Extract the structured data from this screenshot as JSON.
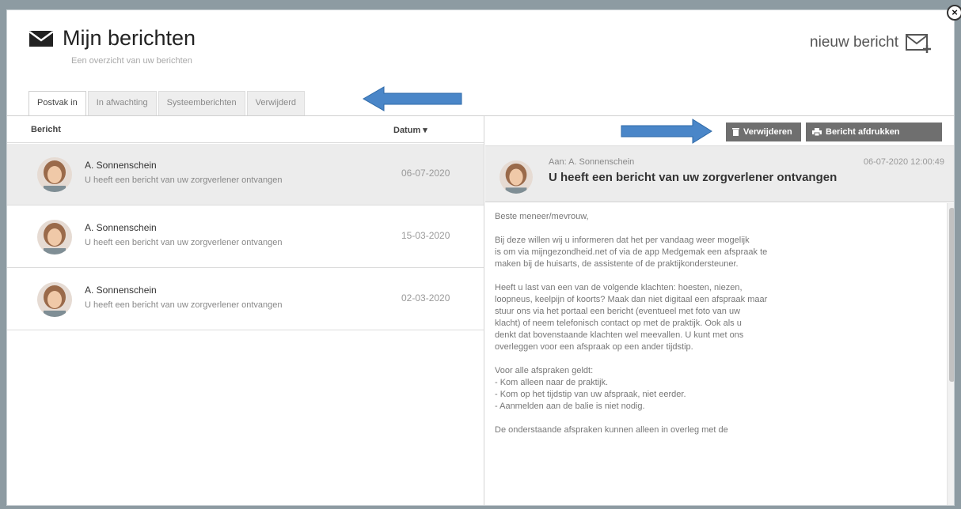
{
  "header": {
    "title": "Mijn berichten",
    "subtitle": "Een overzicht van uw berichten",
    "new_message_label": "nieuw bericht"
  },
  "tabs": [
    {
      "label": "Postvak in",
      "active": true
    },
    {
      "label": "In afwachting",
      "active": false
    },
    {
      "label": "Systeemberichten",
      "active": false
    },
    {
      "label": "Verwijderd",
      "active": false
    }
  ],
  "list": {
    "col_message": "Bericht",
    "col_date": "Datum ▾",
    "rows": [
      {
        "sender": "A. Sonnenschein",
        "subject": "U heeft een bericht van uw zorgverlener ontvangen",
        "date": "06-07-2020",
        "selected": true
      },
      {
        "sender": "A. Sonnenschein",
        "subject": "U heeft een bericht van uw zorgverlener ontvangen",
        "date": "15-03-2020",
        "selected": false
      },
      {
        "sender": "A. Sonnenschein",
        "subject": "U heeft een bericht van uw zorgverlener ontvangen",
        "date": "02-03-2020",
        "selected": false
      }
    ]
  },
  "toolbar": {
    "delete_label": "Verwijderen",
    "print_label": "Bericht afdrukken"
  },
  "detail": {
    "to": "Aan: A. Sonnenschein",
    "datetime": "06-07-2020 12:00:49",
    "subject": "U heeft een bericht van uw zorgverlener ontvangen",
    "body": [
      "Beste meneer/mevrouw,",
      "Bij deze willen wij u informeren dat het per vandaag weer mogelijk\nis om via mijngezondheid.net of via de app Medgemak een afspraak te\nmaken bij de huisarts, de assistente of de praktijkondersteuner.",
      "Heeft u last van een van de volgende klachten: hoesten, niezen,\nloopneus, keelpijn of koorts? Maak dan niet digitaal een afspraak maar\nstuur ons via het portaal een bericht (eventueel met foto van uw\nklacht) of neem telefonisch contact op met de praktijk. Ook als u\ndenkt dat bovenstaande klachten wel meevallen. U kunt met ons\noverleggen voor een afspraak op een ander tijdstip.",
      "Voor alle afspraken geldt:\n- Kom alleen naar de praktijk.\n- Kom op het tijdstip van uw afspraak, niet eerder.\n- Aanmelden aan de balie is niet nodig.",
      "De onderstaande afspraken kunnen alleen in overleg met de"
    ]
  },
  "icons": {
    "close": "close-icon",
    "envelope": "envelope-icon",
    "new_message": "new-message-icon",
    "trash": "trash-icon",
    "printer": "printer-icon",
    "arrow": "blue-arrow-annotation"
  },
  "colors": {
    "annotation_arrow": "#4a86c8",
    "button_bg": "#6f6f6f",
    "selected_row_bg": "#ececec"
  }
}
